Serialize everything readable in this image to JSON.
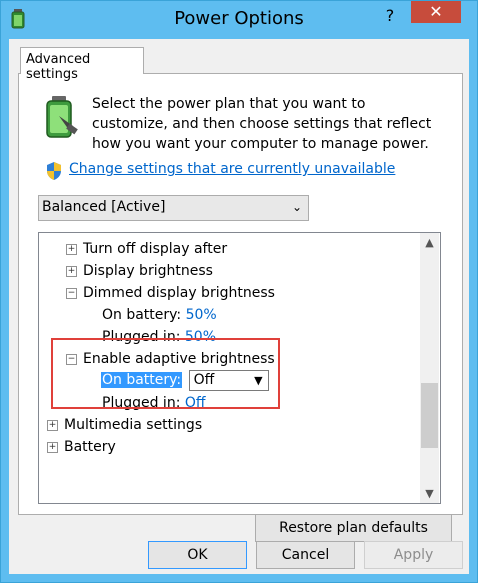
{
  "window": {
    "title": "Power Options",
    "help_label": "?",
    "close_label": "✕"
  },
  "tab": {
    "label": "Advanced settings"
  },
  "description": "Select the power plan that you want to customize, and then choose settings that reflect how you want your computer to manage power.",
  "change_link": "Change settings that are currently unavailable",
  "plan_select": {
    "value": "Balanced [Active]"
  },
  "tree": {
    "turn_off_display": "Turn off display after",
    "display_brightness": "Display brightness",
    "dimmed_display_brightness": "Dimmed display brightness",
    "dimmed_on_battery_label": "On battery:",
    "dimmed_on_battery_value": "50%",
    "dimmed_plugged_label": "Plugged in:",
    "dimmed_plugged_value": "50%",
    "adaptive": "Enable adaptive brightness",
    "adaptive_on_battery_label": "On battery:",
    "adaptive_on_battery_value": "Off",
    "adaptive_plugged_label": "Plugged in:",
    "adaptive_plugged_value": "Off",
    "multimedia": "Multimedia settings",
    "battery": "Battery"
  },
  "buttons": {
    "restore": "Restore plan defaults",
    "ok": "OK",
    "cancel": "Cancel",
    "apply": "Apply"
  },
  "colors": {
    "accent": "#3399ff",
    "link": "#0066cc",
    "highlight_border": "#e0403a",
    "titlebar": "#5ebdf0"
  }
}
